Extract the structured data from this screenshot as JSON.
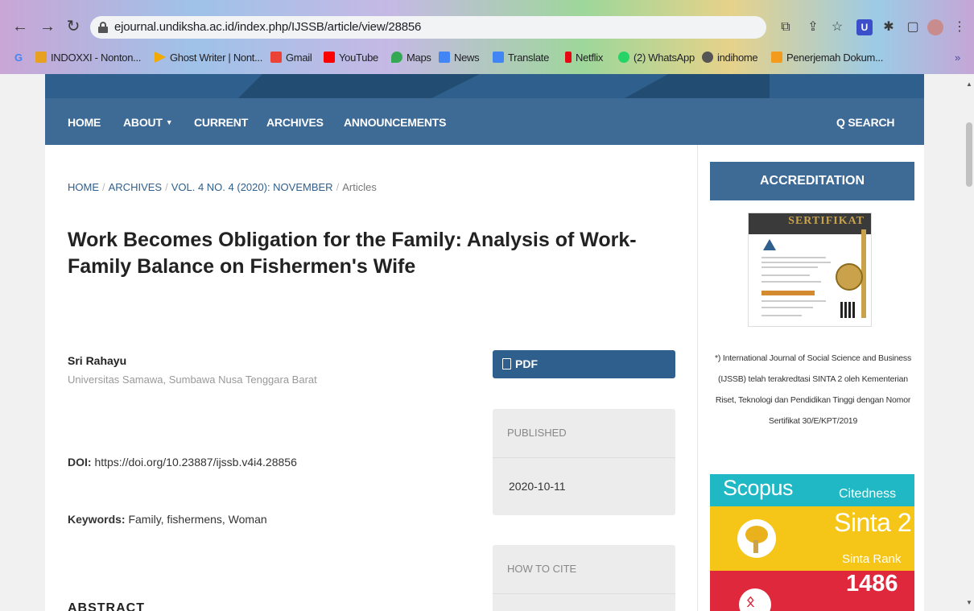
{
  "browser": {
    "url": "ejournal.undiksha.ac.id/index.php/IJSSB/article/view/28856",
    "bookmarks": [
      {
        "label": "INDOXXI - Nonton...",
        "color": "#e8a020"
      },
      {
        "label": "Ghost Writer | Nont...",
        "color": "#f2a900"
      },
      {
        "label": "Gmail",
        "color": "#ea4335"
      },
      {
        "label": "YouTube",
        "color": "#ff0000"
      },
      {
        "label": "Maps",
        "color": "#34a853"
      },
      {
        "label": "News",
        "color": "#4285f4"
      },
      {
        "label": "Translate",
        "color": "#4285f4"
      },
      {
        "label": "Netflix",
        "color": "#e50914"
      },
      {
        "label": "(2) WhatsApp",
        "color": "#25d366"
      },
      {
        "label": "indihome",
        "color": "#555555"
      },
      {
        "label": "Penerjemah Dokum...",
        "color": "#f29b1d"
      }
    ],
    "more_bookmarks": "»"
  },
  "nav": {
    "home": "HOME",
    "about": "ABOUT",
    "current": "CURRENT",
    "archives": "ARCHIVES",
    "announcements": "ANNOUNCEMENTS",
    "search": "SEARCH"
  },
  "breadcrumb": {
    "home": "HOME",
    "archives": "ARCHIVES",
    "issue": "VOL. 4 NO. 4 (2020): NOVEMBER",
    "current": "Articles",
    "separator": "/"
  },
  "article": {
    "title": "Work Becomes Obligation for the Family: Analysis of Work-Family Balance on Fishermen's Wife",
    "author": "Sri Rahayu",
    "affiliation": "Universitas Samawa, Sumbawa Nusa Tenggara Barat",
    "doi_label": "DOI:",
    "doi": "https://doi.org/10.23887/ijssb.v4i4.28856",
    "keywords_label": "Keywords:",
    "keywords": "Family, fishermens, Woman",
    "abstract_heading": "ABSTRACT"
  },
  "side_meta": {
    "pdf_label": "PDF",
    "published_label": "PUBLISHED",
    "published_date": "2020-10-11",
    "cite_label": "HOW TO CITE"
  },
  "sidebar": {
    "accreditation": "ACCREDITATION",
    "certificate_title": "SERTIFIKAT",
    "accreditation_text": "*) International Journal of Social Science and Business (IJSSB) telah terakredtasi SINTA 2 oleh Kementerian Riset, Teknologi dan Pendidikan Tinggi dengan Nomor Sertifikat 30/E/KPT/2019",
    "scopus": "Scopus",
    "citedness": "Citedness",
    "sinta": "Sinta 2",
    "sinta_rank_label": "Sinta Rank",
    "rank_number": "1486"
  },
  "colors": {
    "navbar": "#3e6a96",
    "primary": "#2f5f8c",
    "scopus": "#1fb8c4",
    "sinta": "#f5c518",
    "rank": "#e0283d"
  }
}
